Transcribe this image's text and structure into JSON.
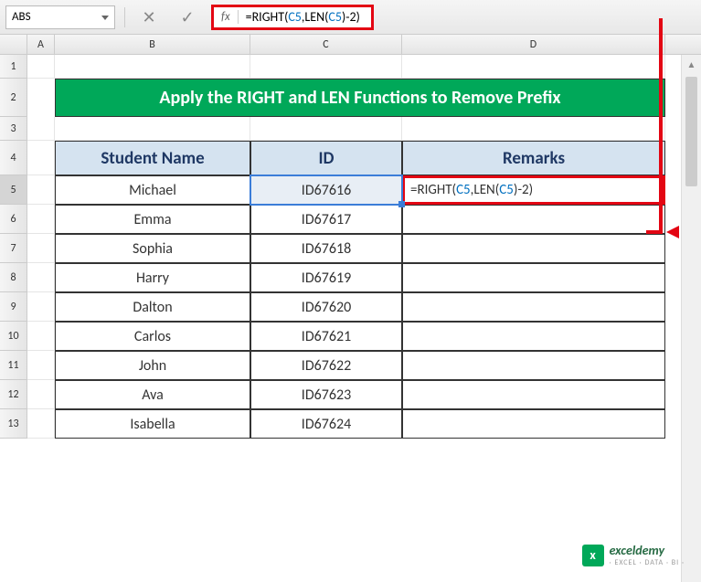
{
  "toolbar": {
    "nameBox": "ABS",
    "fxLabel": "fx",
    "formula": "=RIGHT(C5,LEN(C5)-2)"
  },
  "columns": [
    "A",
    "B",
    "C",
    "D"
  ],
  "rowNumbers": [
    "1",
    "2",
    "3",
    "4",
    "5",
    "6",
    "7",
    "8",
    "9",
    "10",
    "11",
    "12",
    "13"
  ],
  "title": "Apply the RIGHT and LEN Functions to Remove Prefix",
  "headers": {
    "b": "Student Name",
    "c": "ID",
    "d": "Remarks"
  },
  "tableRows": [
    {
      "name": "Michael",
      "id": "ID67616",
      "remarks": "=RIGHT(C5,LEN(C5)-2)"
    },
    {
      "name": "Emma",
      "id": "ID67617",
      "remarks": ""
    },
    {
      "name": "Sophia",
      "id": "ID67618",
      "remarks": ""
    },
    {
      "name": "Harry",
      "id": "ID67619",
      "remarks": ""
    },
    {
      "name": "Dalton",
      "id": "ID67620",
      "remarks": ""
    },
    {
      "name": "Carlos",
      "id": "ID67621",
      "remarks": ""
    },
    {
      "name": "John",
      "id": "ID67622",
      "remarks": ""
    },
    {
      "name": "Ava",
      "id": "ID67623",
      "remarks": ""
    },
    {
      "name": "Isabella",
      "id": "ID67624",
      "remarks": ""
    }
  ],
  "watermark": {
    "logo": "x",
    "title": "exceldemy",
    "sub": "· EXCEL · DATA · BI ·"
  }
}
